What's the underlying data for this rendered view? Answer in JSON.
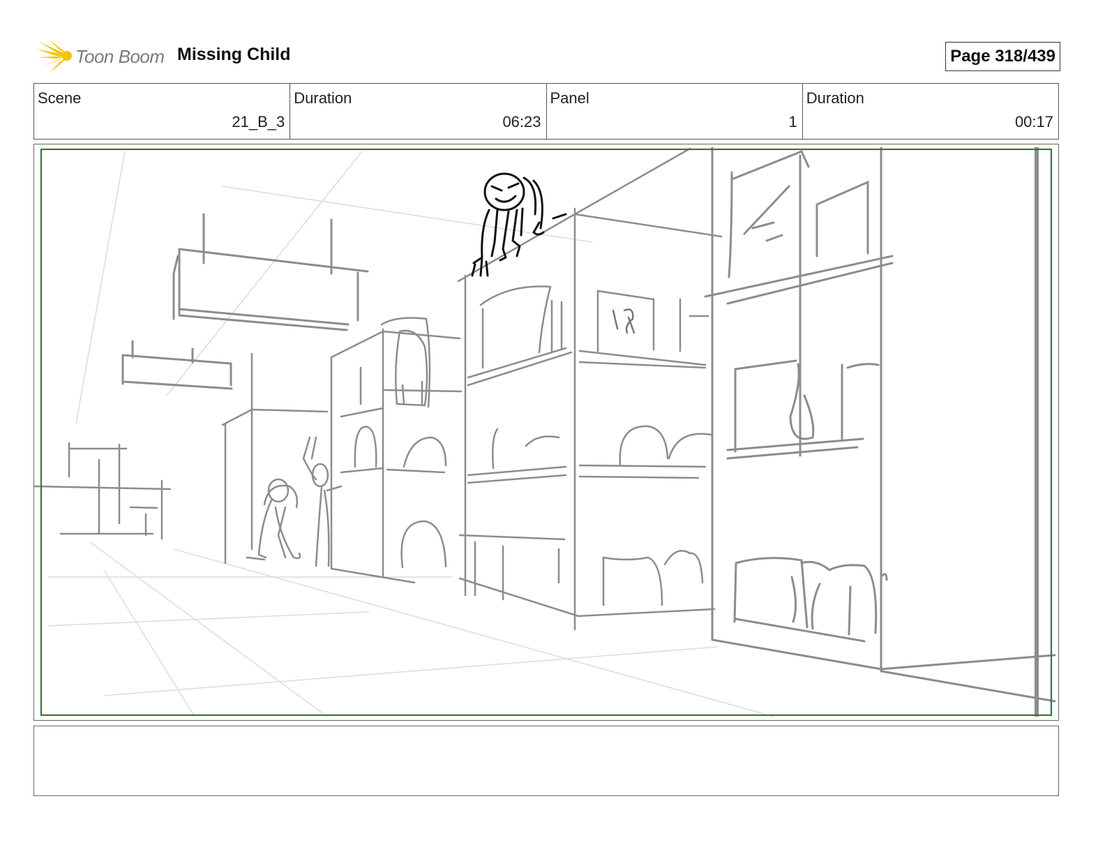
{
  "header": {
    "logo_text": "Toon Boom",
    "project_title": "Missing Child",
    "page_label": "Page 318/439"
  },
  "info": {
    "scene_label": "Scene",
    "scene_value": "21_B_3",
    "scene_duration_label": "Duration",
    "scene_duration_value": "06:23",
    "panel_label": "Panel",
    "panel_value": "1",
    "panel_duration_label": "Duration",
    "panel_duration_value": "00:17"
  },
  "colors": {
    "logo_yellow": "#f5c400",
    "safe_frame": "#2e7d32",
    "sketch_gray": "#8c8c8c",
    "sketch_black": "#111111"
  },
  "notes": {
    "text": ""
  }
}
